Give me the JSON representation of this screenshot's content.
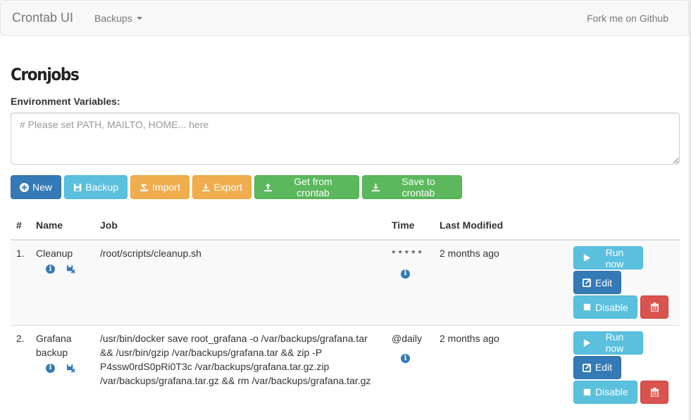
{
  "navbar": {
    "brand": "Crontab UI",
    "backups_menu": "Backups",
    "fork_link": "Fork me on Github"
  },
  "page_title": "Cronjobs",
  "env": {
    "label": "Environment Variables:",
    "value": "",
    "placeholder": "# Please set PATH, MAILTO, HOME... here"
  },
  "toolbar": {
    "new": "New",
    "backup": "Backup",
    "import": "Import",
    "export": "Export",
    "get_from_crontab": "Get from crontab",
    "save_to_crontab": "Save to crontab"
  },
  "table": {
    "headers": [
      "#",
      "Name",
      "Job",
      "Time",
      "Last Modified"
    ],
    "rows": [
      {
        "num": "1.",
        "name": "Cleanup",
        "job": "/root/scripts/cleanup.sh",
        "time": "* * * * *",
        "modified": "2 months ago"
      },
      {
        "num": "2.",
        "name": "Grafana backup",
        "job": "/usr/bin/docker save root_grafana -o /var/backups/grafana.tar && /usr/bin/gzip /var/backups/grafana.tar && zip -P P4ssw0rdS0pRi0T3c /var/backups/grafana.tar.gz.zip /var/backups/grafana.tar.gz && rm /var/backups/grafana.tar.gz",
        "time": "@daily",
        "modified": "2 months ago"
      }
    ],
    "actions": {
      "run_now": "Run now",
      "edit": "Edit",
      "disable": "Disable"
    }
  },
  "icons": {
    "new": "plus-circle-icon",
    "backup": "floppy-icon",
    "import": "import-icon",
    "export": "download-icon",
    "get_from_crontab": "upload-icon",
    "save_to_crontab": "download-icon",
    "info": "info-icon",
    "backup_remove": "floppy-remove-icon",
    "run": "play-icon",
    "edit": "edit-icon",
    "disable": "stop-icon",
    "delete": "trash-icon"
  },
  "colors": {
    "primary": "#337ab7",
    "info": "#5bc0de",
    "warning": "#f0ad4e",
    "success": "#5cb85c",
    "danger": "#d9534f"
  }
}
